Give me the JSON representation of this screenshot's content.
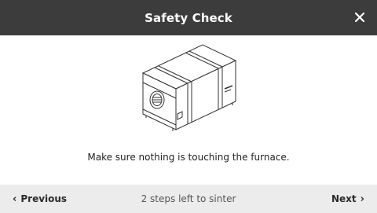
{
  "header": {
    "title": "Safety Check",
    "close_icon": "close-icon"
  },
  "main": {
    "illustration": "furnace-illustration",
    "instruction": "Make sure nothing is touching the furnace."
  },
  "footer": {
    "previous_label": "Previous",
    "previous_icon": "chevron-left-icon",
    "steps_text": "2 steps left to sinter",
    "next_label": "Next",
    "next_icon": "chevron-right-icon"
  },
  "colors": {
    "header_bg": "#3c3c3c",
    "footer_bg": "#ececec"
  }
}
